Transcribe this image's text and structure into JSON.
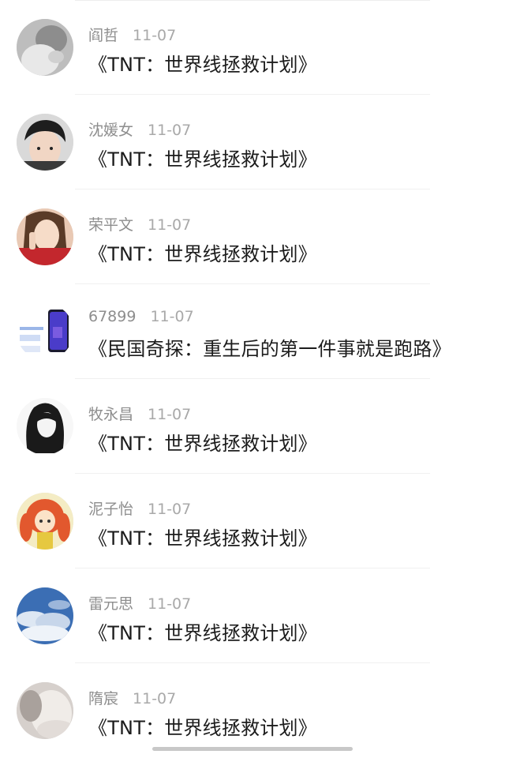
{
  "comments": [
    {
      "user": "阎哲",
      "date": "11-07",
      "title": "《TNT：世界线拯救计划》",
      "avatar_icon": "grayscale-portrait-avatar"
    },
    {
      "user": "沈媛女",
      "date": "11-07",
      "title": "《TNT：世界线拯救计划》",
      "avatar_icon": "boy-portrait-avatar"
    },
    {
      "user": "荣平文",
      "date": "11-07",
      "title": "《TNT：世界线拯救计划》",
      "avatar_icon": "girl-selfie-avatar"
    },
    {
      "user": "67899",
      "date": "11-07",
      "title": "《民国奇探：重生后的第一件事就是跑路》",
      "avatar_icon": "phone-ad-avatar"
    },
    {
      "user": "牧永昌",
      "date": "11-07",
      "title": "《TNT：世界线拯救计划》",
      "avatar_icon": "anime-sketch-avatar"
    },
    {
      "user": "泥子怡",
      "date": "11-07",
      "title": "《TNT：世界线拯救计划》",
      "avatar_icon": "anime-redhair-avatar"
    },
    {
      "user": "雷元思",
      "date": "11-07",
      "title": "《TNT：世界线拯救计划》",
      "avatar_icon": "cloudy-sky-avatar"
    },
    {
      "user": "隋宸",
      "date": "11-07",
      "title": "《TNT：世界线拯救计划》",
      "avatar_icon": "soft-blur-avatar"
    }
  ]
}
